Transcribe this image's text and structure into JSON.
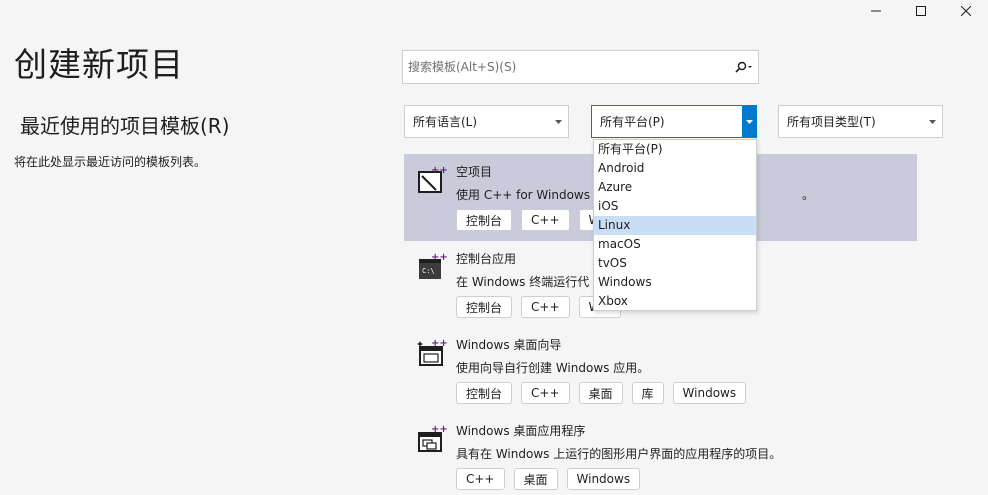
{
  "window": {
    "controls": [
      "minimize-icon",
      "maximize-icon",
      "close-icon"
    ]
  },
  "page": {
    "title": "创建新项目",
    "recent_title": "最近使用的项目模板(R)",
    "recent_empty": "将在此处显示最近访问的模板列表。"
  },
  "search": {
    "placeholder": "搜索模板(Alt+S)(S)",
    "icon": "search-icon"
  },
  "filters": {
    "language": "所有语言(L)",
    "platform": "所有平台(P)",
    "project_type": "所有项目类型(T)",
    "platform_options": [
      "所有平台(P)",
      "Android",
      "Azure",
      "iOS",
      "Linux",
      "macOS",
      "tvOS",
      "Windows",
      "Xbox"
    ],
    "hovered_option": "Linux"
  },
  "templates": [
    {
      "name": "空项目",
      "description": "使用 C++ for Windows",
      "description_tail": "。",
      "tags": [
        "控制台",
        "C++",
        "Win"
      ],
      "icon": "empty-project-icon"
    },
    {
      "name": "控制台应用",
      "description": "在 Windows 终端运行代",
      "tags": [
        "控制台",
        "C++",
        "Win"
      ],
      "icon": "console-app-icon"
    },
    {
      "name": "Windows 桌面向导",
      "description": "使用向导自行创建 Windows 应用。",
      "tags": [
        "控制台",
        "C++",
        "桌面",
        "库",
        "Windows"
      ],
      "icon": "desktop-wizard-icon"
    },
    {
      "name": "Windows 桌面应用程序",
      "description": "具有在 Windows 上运行的图形用户界面的应用程序的项目。",
      "tags": [
        "C++",
        "桌面",
        "Windows"
      ],
      "icon": "desktop-app-icon"
    }
  ],
  "colors": {
    "accent": "#007acc",
    "selected_row": "#c9cbdb",
    "hover_option": "#c9def5",
    "cpp_purple": "#68217a"
  }
}
